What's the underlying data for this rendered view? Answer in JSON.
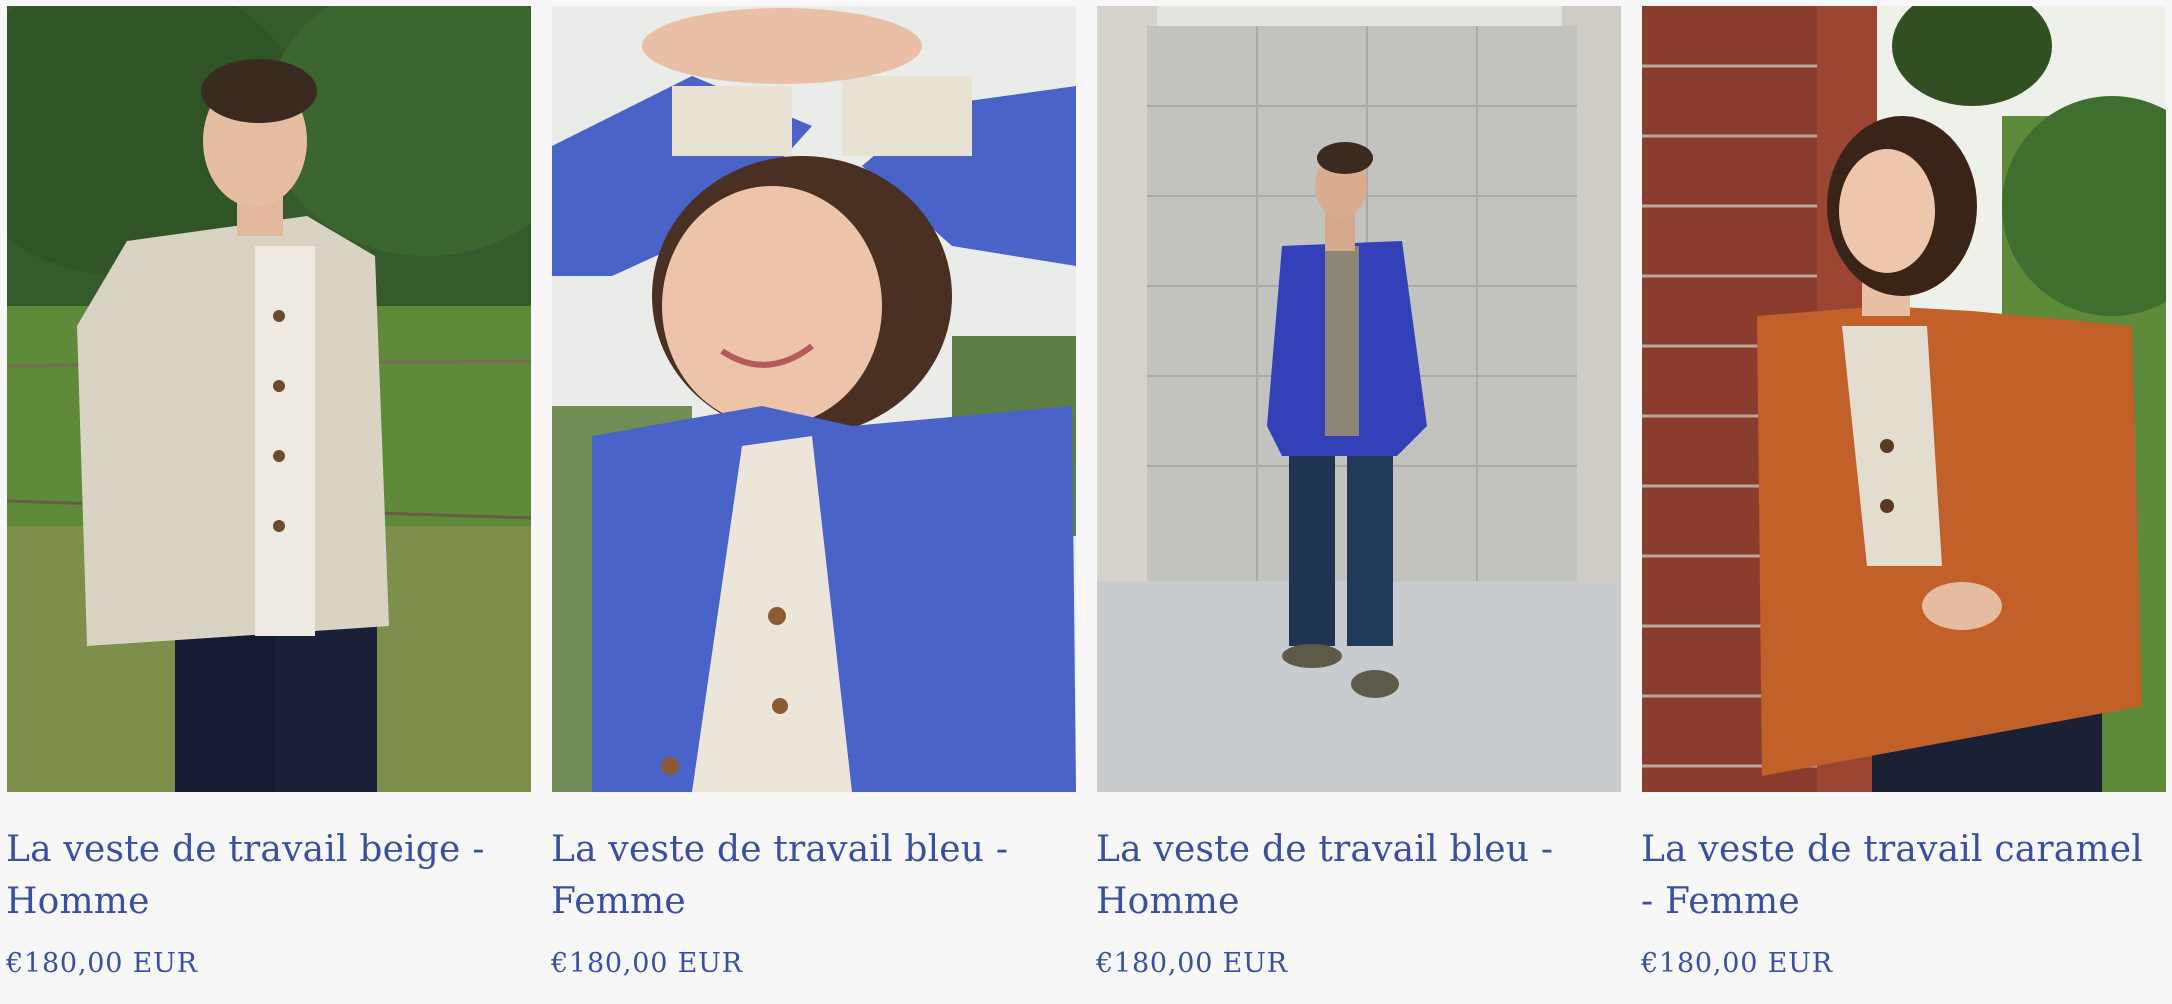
{
  "products": [
    {
      "title": "La veste de travail beige - Homme",
      "price": "€180,00 EUR",
      "jacket_color": "#d9d3c4"
    },
    {
      "title": "La veste de travail bleu - Femme",
      "price": "€180,00 EUR",
      "jacket_color": "#4a63c8"
    },
    {
      "title": "La veste de travail bleu - Homme",
      "price": "€180,00 EUR",
      "jacket_color": "#3340b8"
    },
    {
      "title": "La veste de travail caramel - Femme",
      "price": "€180,00 EUR",
      "jacket_color": "#c2602a"
    }
  ],
  "colors": {
    "text_accent": "#3b4fa0",
    "background": "#f7f7f7"
  }
}
